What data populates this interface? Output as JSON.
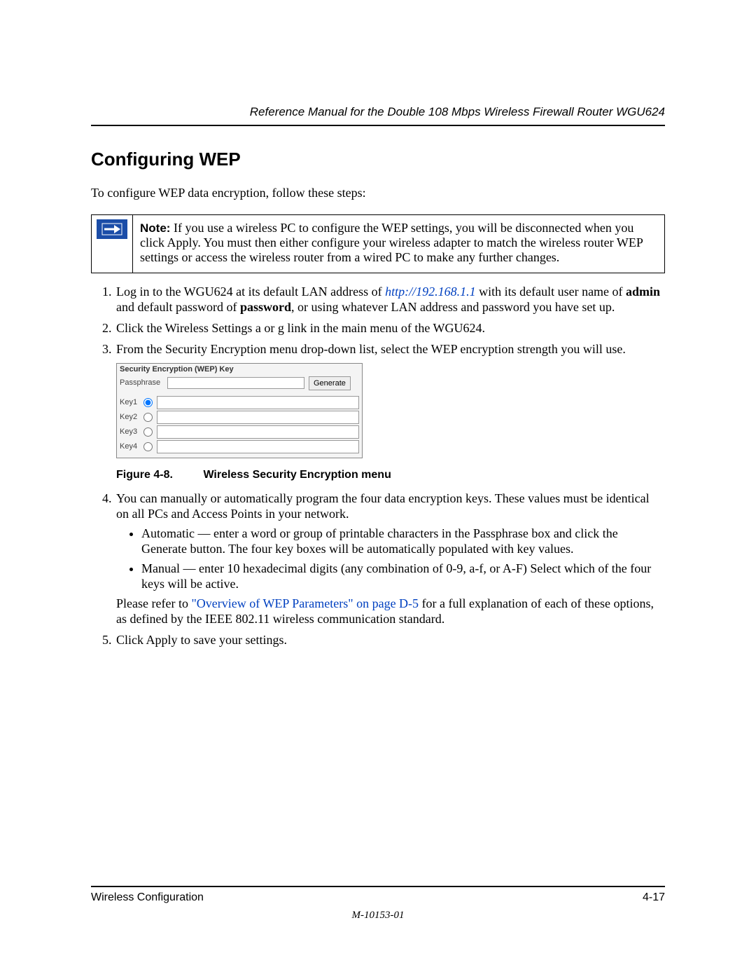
{
  "header": {
    "running_title": "Reference Manual for the Double 108 Mbps Wireless Firewall Router WGU624"
  },
  "section": {
    "title": "Configuring WEP",
    "intro": "To configure WEP data encryption, follow these steps:"
  },
  "note": {
    "label": "Note:",
    "text": "If you use a wireless PC to configure the WEP settings, you will be disconnected when you click Apply. You must then either configure your wireless adapter to match the wireless router WEP settings or access the wireless router from a wired PC to make any further changes."
  },
  "steps": {
    "s1": {
      "t1": "Log in to the WGU624 at its default LAN address of ",
      "link": "http://192.168.1.1",
      "t2": " with its default user name of ",
      "b1": "admin",
      "t3": " and default password of ",
      "b2": "password",
      "t4": ", or using whatever LAN address and password you have set up."
    },
    "s2": "Click the Wireless Settings a or g link in the main menu of the WGU624.",
    "s3": "From the Security Encryption menu drop-down list, select the WEP encryption strength you will use.",
    "s4": {
      "lead": "You can manually or automatically program the four data encryption keys. These values must be identical on all PCs and Access Points in your network.",
      "bul1": "Automatic — enter a word or group of printable characters in the Passphrase box and click the Generate button. The four key boxes will be automatically populated with key values.",
      "bul2": "Manual — enter 10 hexadecimal digits (any combination of 0-9, a-f, or A-F) Select which of the four keys will be active.",
      "refer_pre": "Please refer to ",
      "refer_link": "\"Overview of WEP Parameters\" on page D-5",
      "refer_post": " for a full explanation of each of these options, as defined by the IEEE 802.11 wireless communication standard."
    },
    "s5": "Click Apply to save your settings."
  },
  "figure": {
    "panel_title": "Security Encryption (WEP) Key",
    "passphrase_label": "Passphrase",
    "generate": "Generate",
    "keys": [
      "Key1",
      "Key2",
      "Key3",
      "Key4"
    ],
    "caption_num": "Figure 4-8.",
    "caption_text": "Wireless Security Encryption menu"
  },
  "footer": {
    "section_name": "Wireless Configuration",
    "page_number": "4-17",
    "doc_id": "M-10153-01"
  }
}
